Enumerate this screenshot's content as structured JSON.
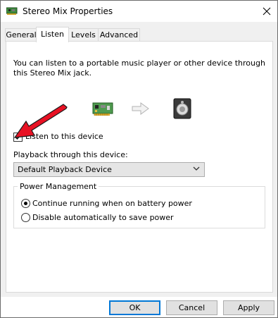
{
  "window": {
    "title": "Stereo Mix Properties"
  },
  "tabs": [
    {
      "label": "General"
    },
    {
      "label": "Listen"
    },
    {
      "label": "Levels"
    },
    {
      "label": "Advanced"
    }
  ],
  "listen": {
    "description": "You can listen to a portable music player or other device through this Stereo Mix jack.",
    "checkbox_label": "Listen to this device",
    "checkbox_checked": true,
    "playback_label": "Playback through this device:",
    "playback_value": "Default Playback Device"
  },
  "power": {
    "title": "Power Management",
    "option1": "Continue running when on battery power",
    "option2": "Disable automatically to save power",
    "selected": "option1"
  },
  "buttons": {
    "ok": "OK",
    "cancel": "Cancel",
    "apply": "Apply"
  },
  "colors": {
    "annotation_arrow": "#e81123",
    "accent": "#0078d7"
  },
  "icons": {
    "app": "sound-card-icon",
    "source": "sound-card-icon",
    "direction": "arrow-right-icon",
    "destination": "speaker-icon"
  }
}
